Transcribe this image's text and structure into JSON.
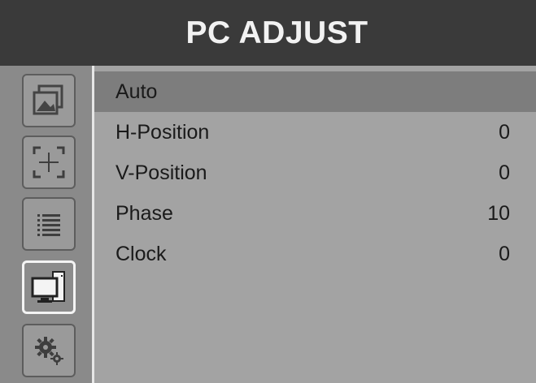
{
  "header": {
    "title": "PC ADJUST"
  },
  "sidebar": {
    "items": [
      {
        "icon": "picture-icon",
        "active": false
      },
      {
        "icon": "aspect-crosshair-icon",
        "active": false
      },
      {
        "icon": "list-icon",
        "active": false
      },
      {
        "icon": "pc-monitor-icon",
        "active": true
      },
      {
        "icon": "gear-settings-icon",
        "active": false
      }
    ]
  },
  "menu": {
    "items": [
      {
        "label": "Auto",
        "value": "",
        "selected": true
      },
      {
        "label": "H-Position",
        "value": "0",
        "selected": false
      },
      {
        "label": "V-Position",
        "value": "0",
        "selected": false
      },
      {
        "label": "Phase",
        "value": "10",
        "selected": false
      },
      {
        "label": "Clock",
        "value": "0",
        "selected": false
      }
    ]
  },
  "colors": {
    "header_bg": "#3a3a3a",
    "header_text": "#f2f2f2",
    "panel_bg": "#a3a3a3",
    "sidebar_bg": "#8a8a8a",
    "selected_row": "#7d7d7d",
    "active_border": "#f4f4f4"
  }
}
